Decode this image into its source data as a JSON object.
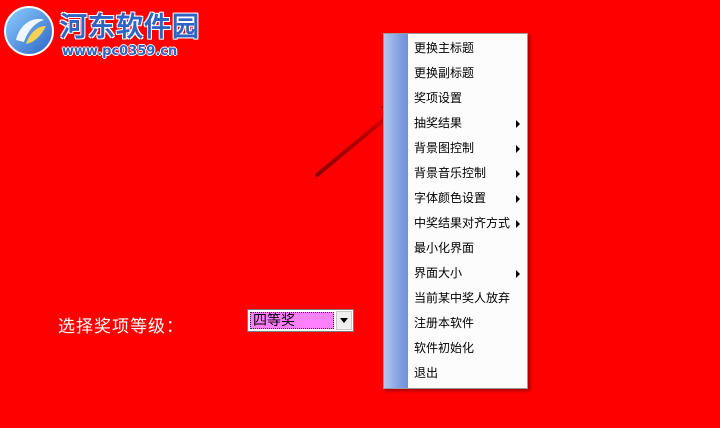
{
  "watermark": {
    "title": "河东软件园",
    "url": "www.pc0359.cn"
  },
  "form": {
    "level_label": "选择奖项等级：",
    "level_value": "四等奖"
  },
  "context_menu": {
    "items": [
      {
        "label": "更换主标题",
        "submenu": false
      },
      {
        "label": "更换副标题",
        "submenu": false
      },
      {
        "label": "奖项设置",
        "submenu": false
      },
      {
        "label": "抽奖结果",
        "submenu": true
      },
      {
        "label": "背景图控制",
        "submenu": true
      },
      {
        "label": "背景音乐控制",
        "submenu": true
      },
      {
        "label": "字体颜色设置",
        "submenu": true
      },
      {
        "label": "中奖结果对齐方式",
        "submenu": true
      },
      {
        "label": "最小化界面",
        "submenu": false
      },
      {
        "label": "界面大小",
        "submenu": true
      },
      {
        "label": "当前某中奖人放弃",
        "submenu": false
      },
      {
        "label": "注册本软件",
        "submenu": false
      },
      {
        "label": "软件初始化",
        "submenu": false
      },
      {
        "label": "退出",
        "submenu": false
      }
    ]
  },
  "colors": {
    "background": "#fe0000",
    "select_highlight": "#ff80ff",
    "menu_strip": "#7d9de0",
    "watermark_blue": "#2f63c4",
    "arrow": "#c00000"
  },
  "icons": {
    "watermark_logo": "pc0359-logo-icon",
    "arrow": "pointer-arrow-annotation",
    "dropdown": "chevron-down-icon",
    "submenu": "submenu-arrow-icon"
  }
}
